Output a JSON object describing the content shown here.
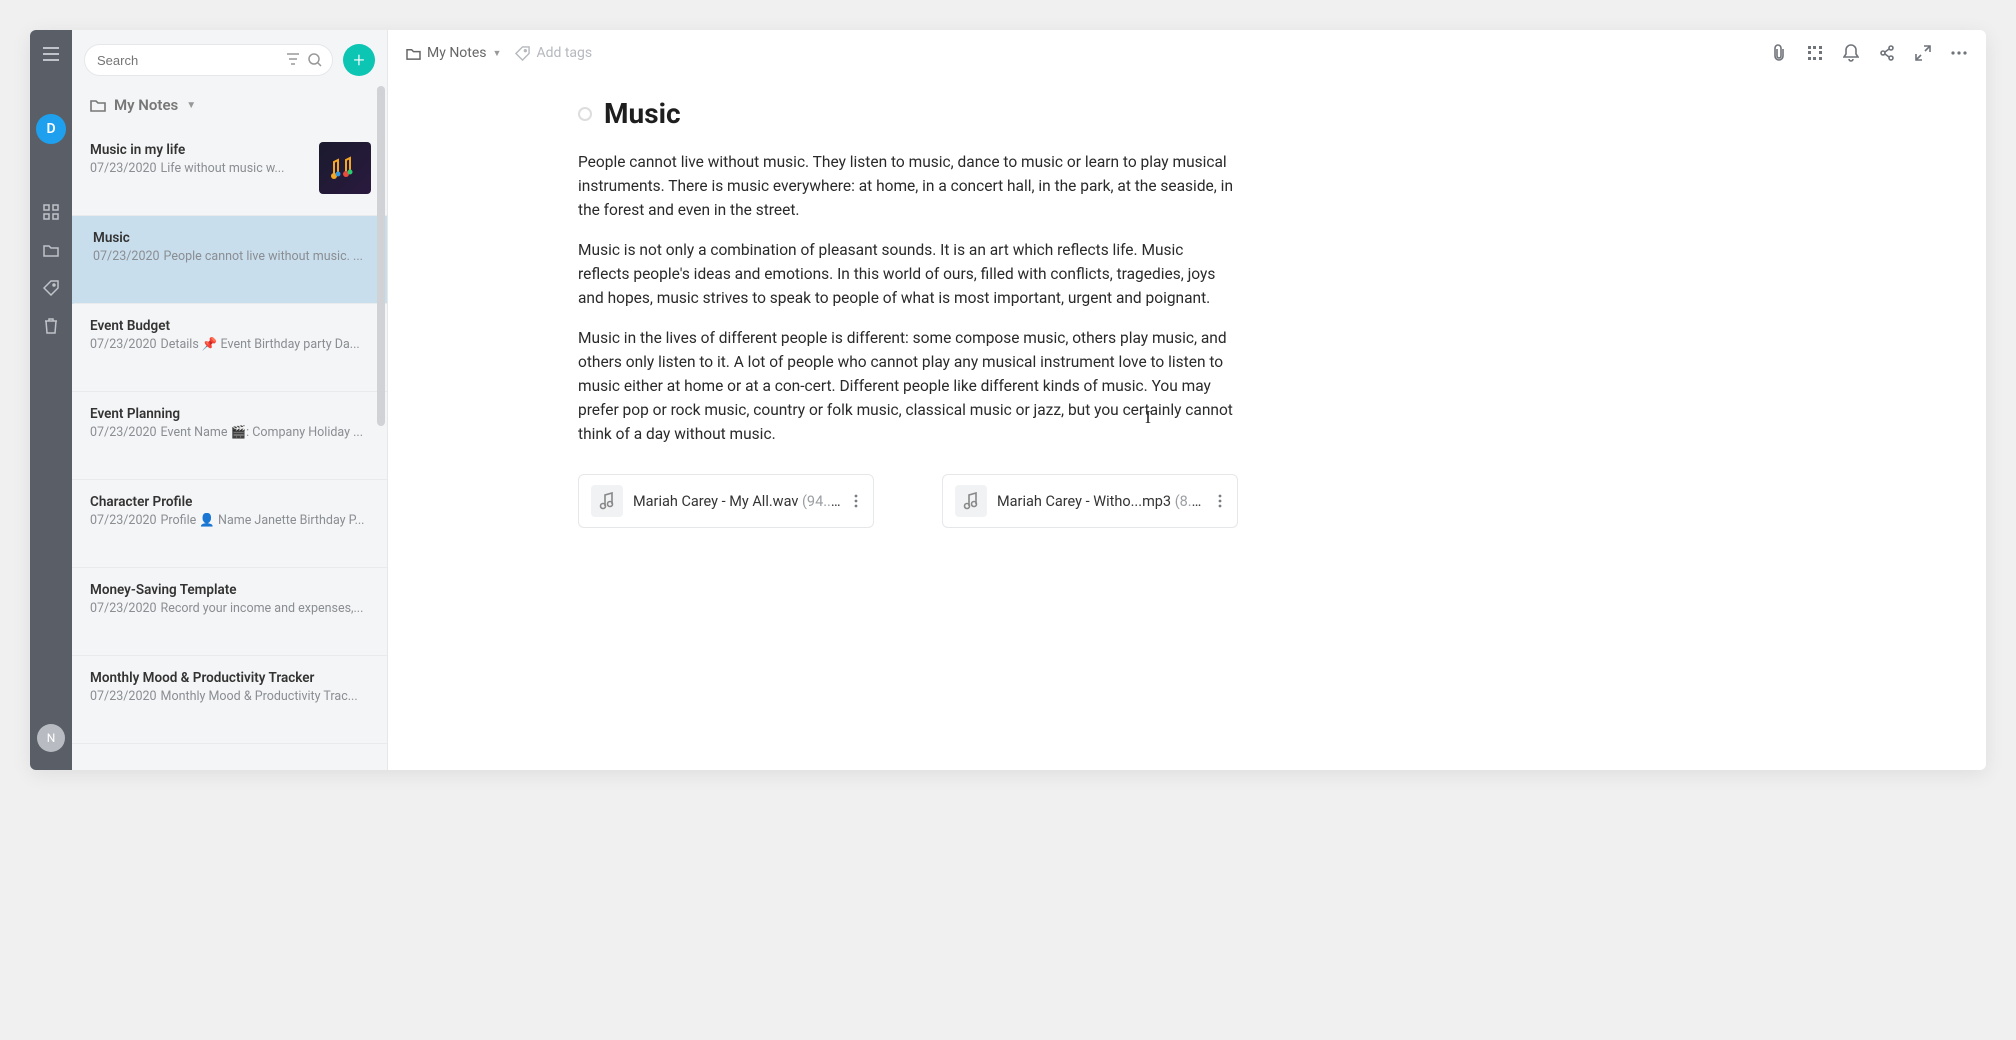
{
  "rail": {
    "avatar_top": "D",
    "avatar_bottom": "N"
  },
  "search": {
    "placeholder": "Search"
  },
  "add_button": "+",
  "folder": {
    "label": "My Notes"
  },
  "notes": [
    {
      "title": "Music in my life",
      "date": "07/23/2020",
      "snippet": "Life without music w...",
      "thumb": true
    },
    {
      "title": "Music",
      "date": "07/23/2020",
      "snippet": "People cannot live without music. ...",
      "selected": true
    },
    {
      "title": "Event Budget",
      "date": "07/23/2020",
      "snippet": "Details 📌 Event Birthday party Da..."
    },
    {
      "title": "Event Planning",
      "date": "07/23/2020",
      "snippet": "Event Name 🎬: Company Holiday ..."
    },
    {
      "title": "Character Profile",
      "date": "07/23/2020",
      "snippet": "Profile 👤 Name Janette Birthday P..."
    },
    {
      "title": "Money-Saving Template",
      "date": "07/23/2020",
      "snippet": "Record your income and expenses,..."
    },
    {
      "title": "Monthly Mood & Productivity Tracker",
      "date": "07/23/2020",
      "snippet": "Monthly Mood & Productivity Trac..."
    }
  ],
  "breadcrumb": {
    "label": "My Notes"
  },
  "add_tags": "Add tags",
  "page": {
    "title": "Music",
    "paragraphs": [
      "People cannot live without music. They listen to music, dance to music or learn to play musical instruments. There is music everywhere: at home, in a concert hall, in the park, at the seaside, in the forest and even in the street.",
      "Music is not only a combination of pleasant sounds. It is an art which reflects life. Music reflects people's ideas and emotions. In this world of ours, filled with conflicts, tragedies, joys and hopes, music strives to speak to people of what is most important, urgent and poignant.",
      "Music in the lives of different people is different: some compose music, others play music, and others only listen to it. A lot of people who cannot play any musical instrument love to listen to music either at home or at a con-cert. Different people like different kinds of music. You may prefer pop or rock music, country or folk music, classical music or jazz, but you certainly cannot think of a day without music."
    ]
  },
  "attachments": [
    {
      "name": "Mariah Carey - My All.wav",
      "size": "(94....)"
    },
    {
      "name": "Mariah Carey - Witho...mp3",
      "size": "(8....)"
    }
  ]
}
